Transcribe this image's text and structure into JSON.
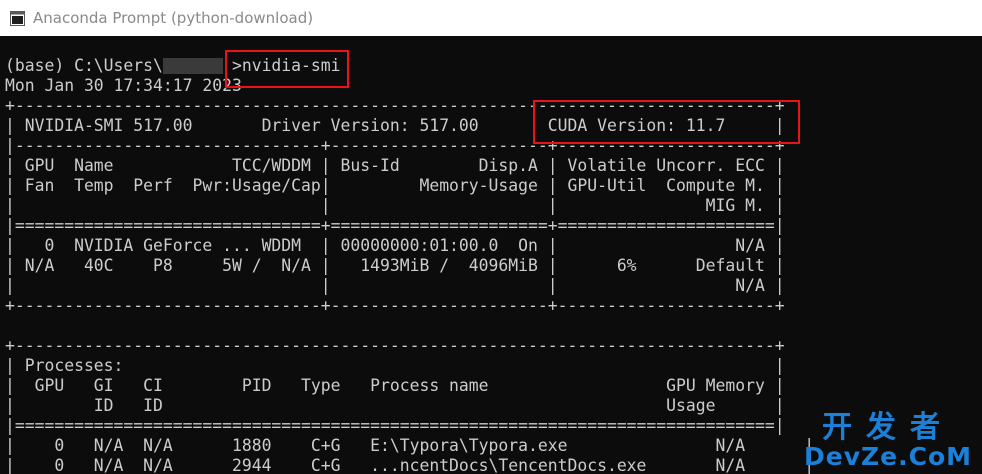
{
  "window": {
    "title": "Anaconda Prompt (python-download)",
    "icon": "terminal-icon"
  },
  "console": {
    "lines": [
      "(base) C:\\Users\\       >nvidia-smi",
      "Mon Jan 30 17:34:17 2023",
      "+-----------------------------------------------------------------------------+",
      "| NVIDIA-SMI 517.00       Driver Version: 517.00       CUDA Version: 11.7     |",
      "|-------------------------------+----------------------+----------------------+",
      "| GPU  Name            TCC/WDDM | Bus-Id        Disp.A | Volatile Uncorr. ECC |",
      "| Fan  Temp  Perf  Pwr:Usage/Cap|         Memory-Usage | GPU-Util  Compute M. |",
      "|                               |                      |               MIG M. |",
      "|===============================+======================+======================|",
      "|   0  NVIDIA GeForce ... WDDM  | 00000000:01:00.0  On |                  N/A |",
      "| N/A   40C    P8     5W /  N/A |   1493MiB /  4096MiB |      6%      Default |",
      "|                               |                      |                  N/A |",
      "+-------------------------------+----------------------+----------------------+",
      "",
      "+-----------------------------------------------------------------------------+",
      "| Processes:                                                                  |",
      "|  GPU   GI   CI        PID   Type   Process name                  GPU Memory |",
      "|        ID   ID                                                   Usage      |",
      "|=============================================================================|",
      "|    0   N/A  N/A      1880    C+G   E:\\Typora\\Typora.exe               N/A      |",
      "|    0   N/A  N/A      2944    C+G   ...ncentDocs\\TencentDocs.exe       N/A      |"
    ]
  },
  "watermark": {
    "cn": "开发者",
    "en": "DevZe.CoM"
  },
  "colors": {
    "console_bg": "#0c0c0c",
    "console_fg": "#cccccc",
    "highlight": "#e8141a",
    "watermark": "#1c80d8"
  }
}
